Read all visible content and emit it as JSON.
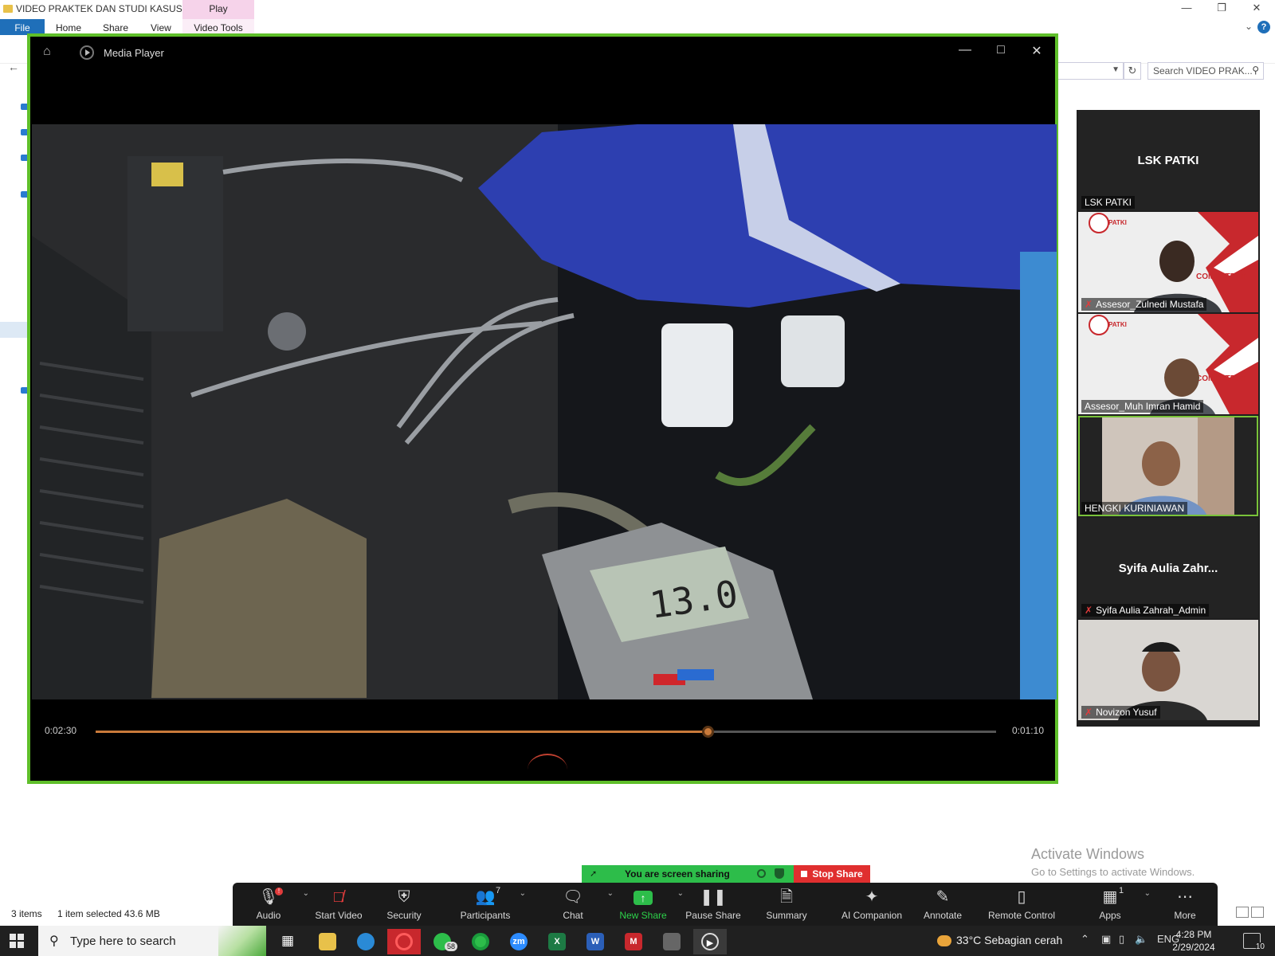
{
  "explorer": {
    "title": "VIDEO PRAKTEK DAN STUDI KASUS",
    "ribbon_tabs": [
      "File",
      "Home",
      "Share",
      "View"
    ],
    "context_tab_group": "Play",
    "context_tab": "Video Tools",
    "search_placeholder": "Search VIDEO PRAK...",
    "status_items": "3 items",
    "status_selection": "1 item selected  43.6 MB"
  },
  "media_player": {
    "title": "Media Player",
    "time_elapsed": "0:02:30",
    "time_remaining": "0:01:10",
    "progress_fraction": 0.68,
    "meter_reading": "13.0"
  },
  "participants": [
    {
      "big_name": "LSK PATKI",
      "label": "LSK PATKI",
      "muted": false,
      "video": false
    },
    {
      "label": "Assesor_Zulnedi Mustafa",
      "muted": true,
      "video": true,
      "logo": "PATKI",
      "brand": "COMPETENT"
    },
    {
      "label": "Assesor_Muh Imran Hamid",
      "muted": false,
      "video": true,
      "logo": "PATKI",
      "brand": "COMPETENT"
    },
    {
      "label": "HENGKI KURINIAWAN",
      "muted": false,
      "video": true,
      "speaking": true
    },
    {
      "big_name": "Syifa Aulia Zahr...",
      "label": "Syifa Aulia Zahrah_Admin",
      "muted": true,
      "video": false
    },
    {
      "label": "Novizon Yusuf",
      "muted": true,
      "video": true
    }
  ],
  "share_banner": {
    "text": "You are screen sharing",
    "stop_label": "Stop Share"
  },
  "toolbar": {
    "audio": "Audio",
    "start_video": "Start Video",
    "security": "Security",
    "participants": "Participants",
    "participants_count": "7",
    "chat": "Chat",
    "new_share": "New Share",
    "pause_share": "Pause Share",
    "summary": "Summary",
    "ai_companion": "AI Companion",
    "annotate": "Annotate",
    "remote_control": "Remote Control",
    "apps": "Apps",
    "apps_count": "1",
    "more": "More"
  },
  "watermark": {
    "line1": "Activate Windows",
    "line2": "Go to Settings to activate Windows."
  },
  "taskbar": {
    "search_placeholder": "Type here to search",
    "whatsapp_badge": "58",
    "weather": "33°C  Sebagian cerah",
    "language": "ENG",
    "time": "4:28 PM",
    "date": "2/29/2024",
    "notification_count": "10"
  },
  "colors": {
    "player_border": "#5fbf2a",
    "seek_accent": "#c97a3a",
    "share_green": "#2dbd4a",
    "stop_red": "#e02f2f"
  }
}
